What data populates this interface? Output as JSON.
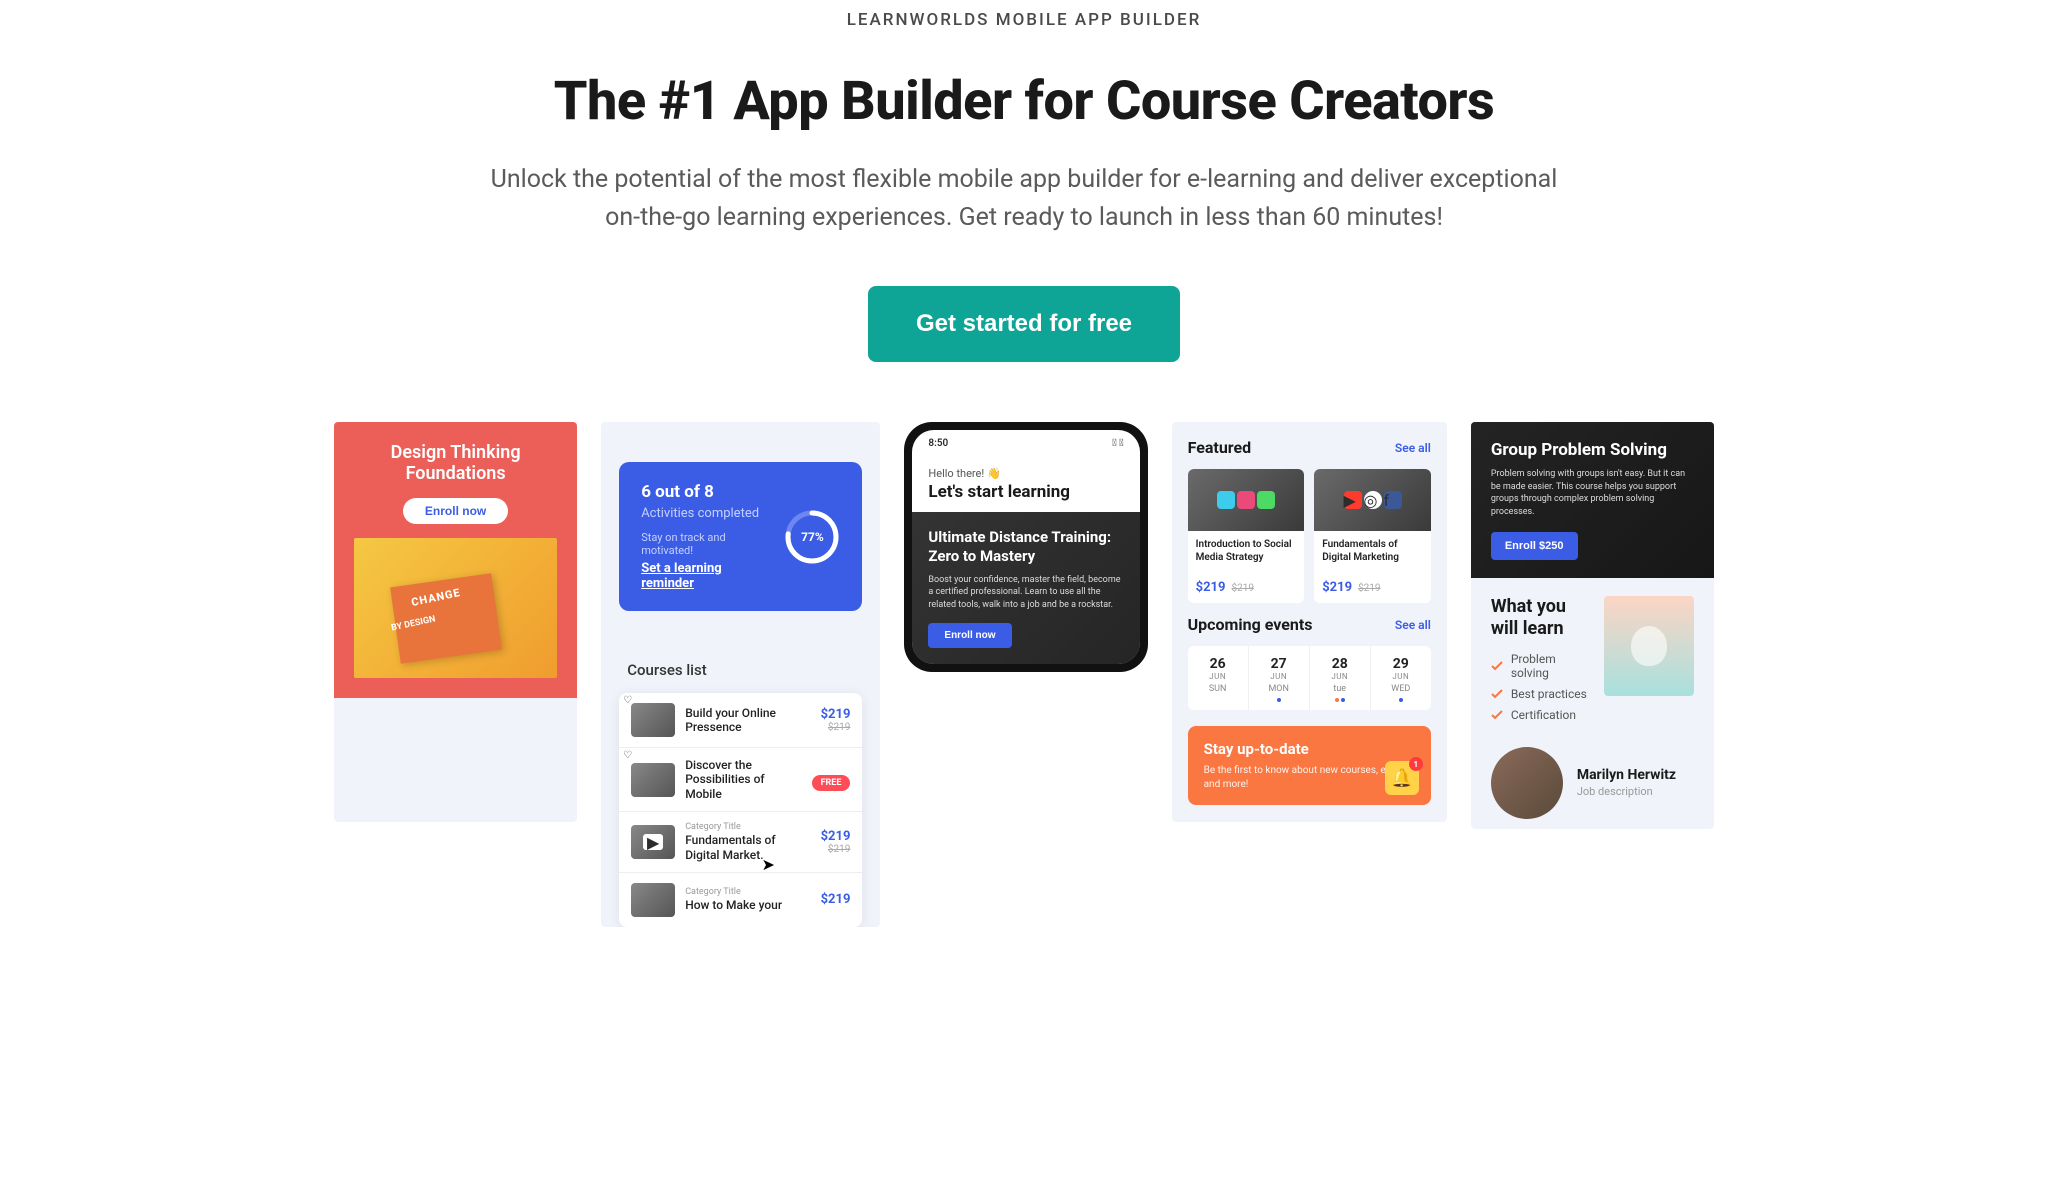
{
  "hero": {
    "eyebrow": "LEARNWORLDS MOBILE APP BUILDER",
    "headline": "The #1 App Builder for Course Creators",
    "subhead": "Unlock the potential of the most flexible mobile app builder for e-learning and deliver exceptional on-the-go learning experiences. Get ready to launch in less than 60 minutes!",
    "cta": "Get started for free"
  },
  "panel1": {
    "title": "Design Thinking Foundations",
    "enroll": "Enroll now",
    "img_text1": "CHANGE",
    "img_text2": "BY DESIGN"
  },
  "panel2": {
    "count": "6 out of 8",
    "label": "Activities completed",
    "hint": "Stay on track and motivated!",
    "action": "Set a learning reminder",
    "percent": "77%",
    "list_title": "Courses list",
    "rows": [
      {
        "title": "Build your Online Pressence",
        "price": "$219",
        "old": "$219"
      },
      {
        "title": "Discover the Possibilities of Mobile",
        "free": "FREE"
      },
      {
        "cat": "Category Title",
        "title": "Fundamentals of Digital Market.",
        "price": "$219",
        "old": "$219"
      },
      {
        "cat": "Category Title",
        "title": "How to Make your",
        "price": "$219"
      }
    ]
  },
  "panel3": {
    "time": "8:50",
    "hello": "Hello there! 👋",
    "start": "Let's start learning",
    "course_title": "Ultimate Distance Training: Zero to Mastery",
    "course_desc": "Boost your confidence, master the field, become a certified professional. Learn to use all the related tools, walk into a job and be a rockstar.",
    "enroll": "Enroll now"
  },
  "panel4": {
    "featured": "Featured",
    "seeall": "See all",
    "cards": [
      {
        "title": "Introduction to Social Media Strategy",
        "price": "$219",
        "old": "$219"
      },
      {
        "title": "Fundamentals of Digital Marketing",
        "price": "$219",
        "old": "$219"
      }
    ],
    "events": "Upcoming events",
    "days": [
      {
        "n": "26",
        "m": "JUN",
        "d": "SUN",
        "dots": []
      },
      {
        "n": "27",
        "m": "JUN",
        "d": "MON",
        "dots": [
          "#3b5de6"
        ]
      },
      {
        "n": "28",
        "m": "JUN",
        "d": "tue",
        "dots": [
          "#fa7742",
          "#3b5de6"
        ]
      },
      {
        "n": "29",
        "m": "JUN",
        "d": "WED",
        "dots": [
          "#3b5de6"
        ]
      }
    ],
    "promo_title": "Stay up-to-date",
    "promo_desc": "Be the first to know about new courses, events, and more!",
    "badge": "1"
  },
  "panel5": {
    "title": "Group Problem Solving",
    "desc": "Problem solving with groups isn't easy. But it can be made easier. This course helps you support groups through complex problem solving processes.",
    "enroll": "Enroll $250",
    "learn_title": "What you will learn",
    "checks": [
      "Problem solving",
      "Best practices",
      "Certification"
    ],
    "person_name": "Marilyn Herwitz",
    "person_role": "Job description"
  }
}
